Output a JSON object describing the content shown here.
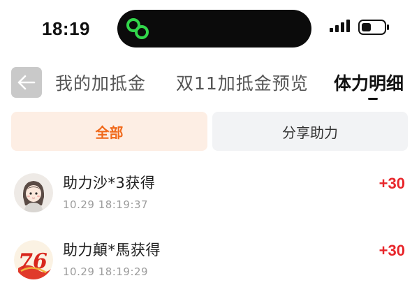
{
  "status": {
    "time": "18:19",
    "island_icon": "link-icon",
    "signal_icon": "cellular-signal-icon",
    "battery_icon": "battery-icon",
    "island_icon_color": "#32d74b"
  },
  "nav": {
    "back_icon": "back-arrow-icon",
    "tabs": [
      {
        "label": "我的加抵金",
        "active": false
      },
      {
        "label": "双11加抵金预览",
        "active": false
      },
      {
        "label": "体力明细",
        "active": true
      }
    ]
  },
  "filters": [
    {
      "label": "全部",
      "active": true
    },
    {
      "label": "分享助力",
      "active": false
    }
  ],
  "records": [
    {
      "title": "助力沙*3获得",
      "time": "10.29 18:19:37",
      "points": "+30",
      "avatar": "cartoon-avatar"
    },
    {
      "title": "助力顛*馬获得",
      "time": "10.29 18:19:29",
      "points": "+30",
      "avatar": "anniversary-76-avatar"
    }
  ],
  "colors": {
    "accent": "#f06a1c",
    "active_filter_bg": "#fdeee4",
    "points": "#e8262b"
  }
}
